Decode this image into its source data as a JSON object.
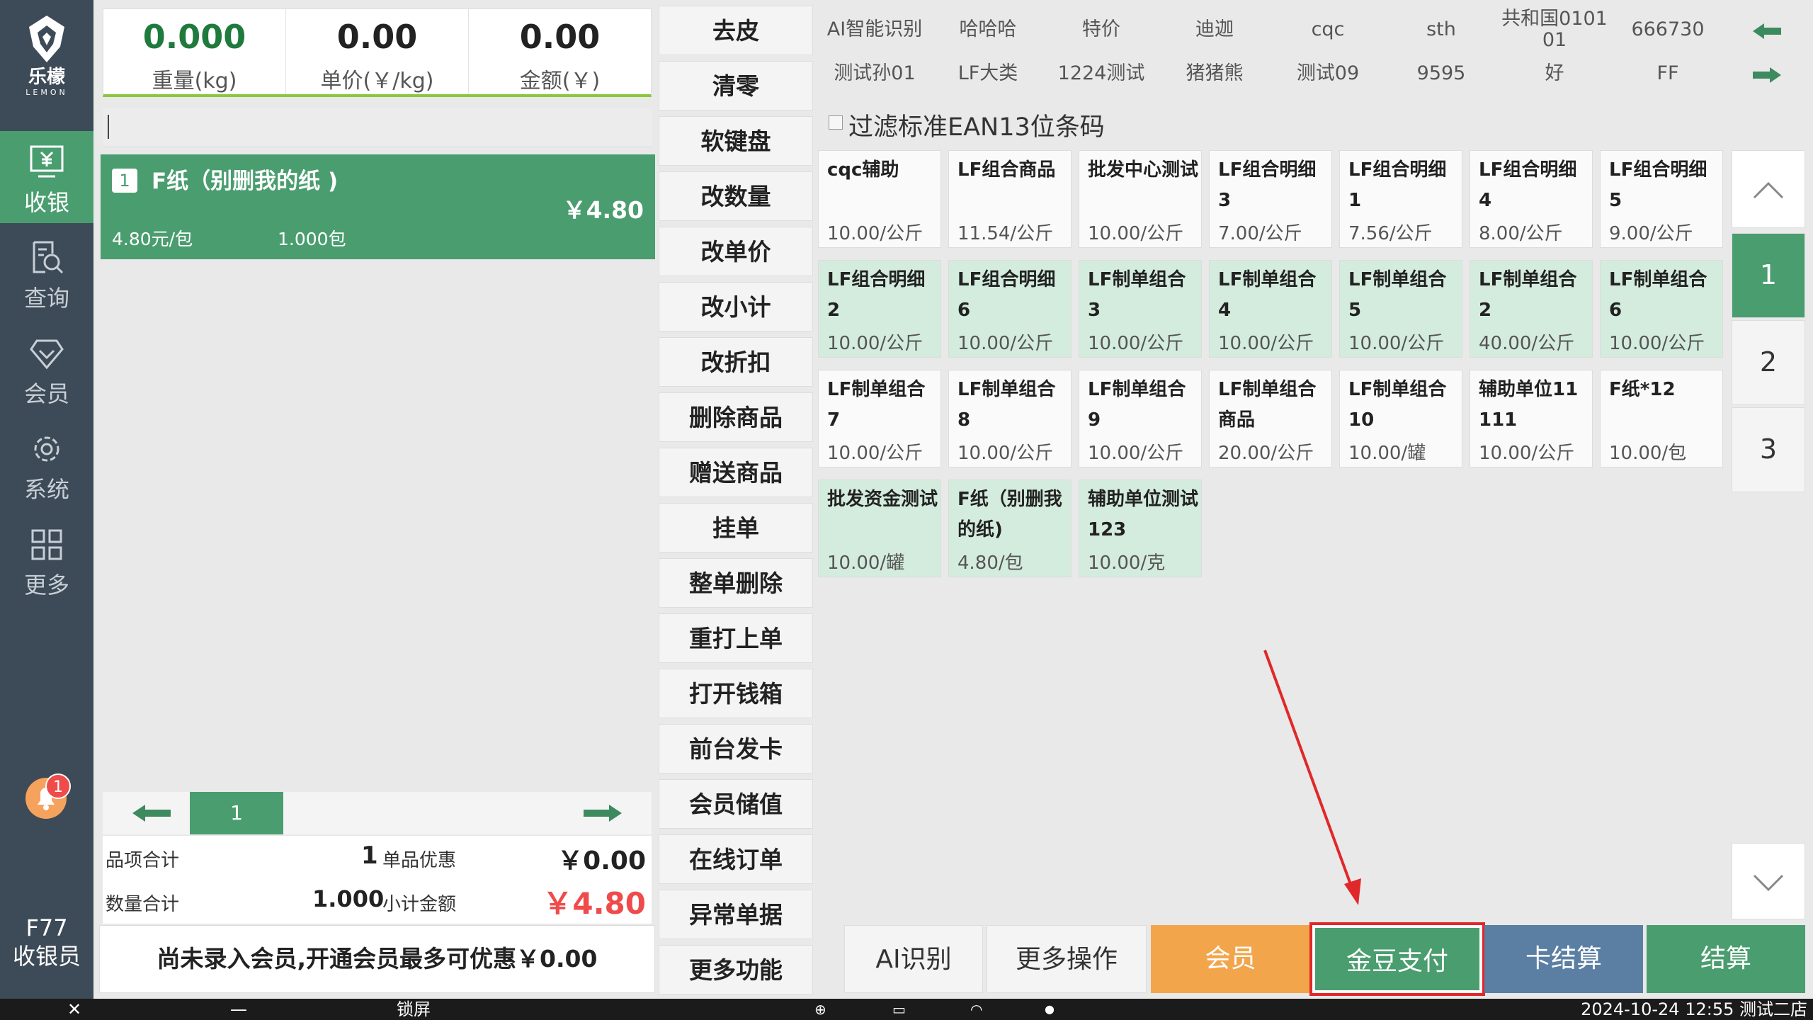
{
  "sidebar": {
    "logo_cn": "乐檬",
    "logo_en": "LEMON",
    "items": [
      {
        "label": "收银",
        "icon": "cashier-icon",
        "active": true
      },
      {
        "label": "查询",
        "icon": "query-icon",
        "active": false
      },
      {
        "label": "会员",
        "icon": "diamond-icon",
        "active": false
      },
      {
        "label": "系统",
        "icon": "gear-icon",
        "active": false
      },
      {
        "label": "更多",
        "icon": "grid-icon",
        "active": false
      }
    ],
    "badge_count": "1",
    "cashier_id": "F77",
    "cashier_label": "收银员"
  },
  "scale": {
    "weight_value": "0.000",
    "weight_label": "重量(kg)",
    "unit_price_value": "0.00",
    "unit_price_label": "单价(￥/kg)",
    "amount_value": "0.00",
    "amount_label": "金额(￥)"
  },
  "cart": {
    "items": [
      {
        "index": "1",
        "name": "F纸（别删我的纸 )",
        "price": "￥4.80",
        "unit_price": "4.80元/包",
        "qty": "1.000包"
      }
    ],
    "page": "1"
  },
  "totals": {
    "item_count_label": "品项合计",
    "item_count": "1",
    "discount_label": "单品优惠",
    "discount": "￥0.00",
    "qty_label": "数量合计",
    "qty": "1.000",
    "subtotal_label": "小计金额",
    "subtotal": "￥4.80"
  },
  "member_tip": "尚未录入会员,开通会员最多可优惠￥0.00",
  "functions": [
    "去皮",
    "清零",
    "软键盘",
    "改数量",
    "改单价",
    "改小计",
    "改折扣",
    "删除商品",
    "赠送商品",
    "挂单",
    "整单删除",
    "重打上单",
    "打开钱箱",
    "前台发卡",
    "会员储值",
    "在线订单",
    "异常单据",
    "更多功能"
  ],
  "categories": {
    "row1": [
      "AI智能识别",
      "哈哈哈",
      "特价",
      "迪迦",
      "cqc",
      "sth",
      "共和国0101 01",
      "666730"
    ],
    "row2": [
      "测试孙01",
      "LF大类",
      "1224测试",
      "猪猪熊",
      "测试09",
      "9595",
      "好",
      "FF"
    ]
  },
  "filter_label": "过滤标准EAN13位条码",
  "products": [
    {
      "name": "cqc辅助",
      "price": "10.00/公斤",
      "green": false
    },
    {
      "name": "LF组合商品",
      "price": "11.54/公斤",
      "green": false
    },
    {
      "name": "批发中心测试",
      "price": "10.00/公斤",
      "green": false
    },
    {
      "name": "LF组合明细3",
      "price": "7.00/公斤",
      "green": false
    },
    {
      "name": "LF组合明细1",
      "price": "7.56/公斤",
      "green": false
    },
    {
      "name": "LF组合明细4",
      "price": "8.00/公斤",
      "green": false
    },
    {
      "name": "LF组合明细5",
      "price": "9.00/公斤",
      "green": false
    },
    {
      "name": "LF组合明细2",
      "price": "10.00/公斤",
      "green": true
    },
    {
      "name": "LF组合明细6",
      "price": "10.00/公斤",
      "green": true
    },
    {
      "name": "LF制单组合3",
      "price": "10.00/公斤",
      "green": true
    },
    {
      "name": "LF制单组合4",
      "price": "10.00/公斤",
      "green": true
    },
    {
      "name": "LF制单组合5",
      "price": "10.00/公斤",
      "green": true
    },
    {
      "name": "LF制单组合2",
      "price": "40.00/公斤",
      "green": true
    },
    {
      "name": "LF制单组合6",
      "price": "10.00/公斤",
      "green": true
    },
    {
      "name": "LF制单组合7",
      "price": "10.00/公斤",
      "green": false
    },
    {
      "name": "LF制单组合8",
      "price": "10.00/公斤",
      "green": false
    },
    {
      "name": "LF制单组合9",
      "price": "10.00/公斤",
      "green": false
    },
    {
      "name": "LF制单组合商品",
      "price": "20.00/公斤",
      "green": false
    },
    {
      "name": "LF制单组合10",
      "price": "10.00/罐",
      "green": false
    },
    {
      "name": "辅助单位11111",
      "price": "10.00/公斤",
      "green": false
    },
    {
      "name": "F纸*12",
      "price": "10.00/包",
      "green": false
    },
    {
      "name": "批发资金测试",
      "price": "10.00/罐",
      "green": true
    },
    {
      "name": "F纸（别删我的纸)",
      "price": "4.80/包",
      "green": true
    },
    {
      "name": "辅助单位测试123",
      "price": "10.00/克",
      "green": true
    }
  ],
  "page_nav": [
    "1",
    "2",
    "3"
  ],
  "actions": {
    "ai": "AI识别",
    "more": "更多操作",
    "member": "会员",
    "bean_pay": "金豆支付",
    "card": "卡结算",
    "checkout": "结算"
  },
  "taskbar": {
    "lock": "锁屏",
    "datetime_store": "2024-10-24 12:55 测试二店"
  },
  "colors": {
    "sidebar": "#3d4a57",
    "accent_green": "#4a9d6f",
    "tile_green": "#d4ecdd",
    "orange": "#f2a54a",
    "blue": "#5b7fa3",
    "annotation_red": "#e0282a"
  }
}
